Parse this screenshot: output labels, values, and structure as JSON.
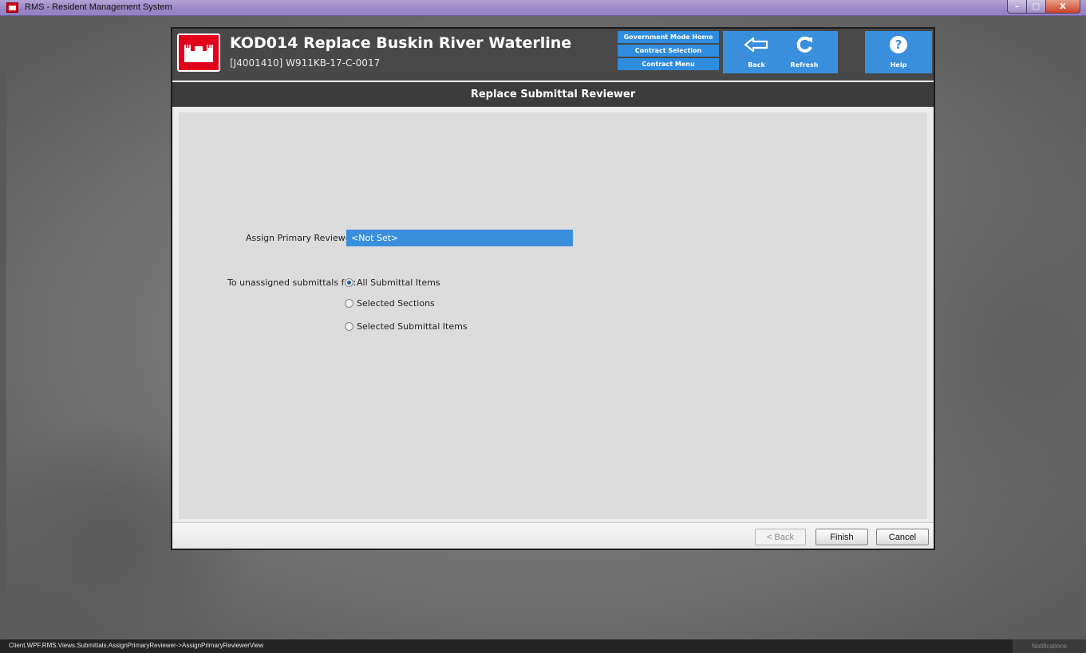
{
  "window": {
    "title": "RMS - Resident Management System",
    "controls": {
      "minimize": "–",
      "maximize": "□",
      "close": "X"
    }
  },
  "header": {
    "title": "KOD014 Replace Buskin River Waterline",
    "subtitle": "[J4001410] W911KB-17-C-0017",
    "nav": {
      "government_mode_home": "Government Mode Home",
      "contract_selection": "Contract Selection",
      "contract_menu": "Contract Menu"
    },
    "tiles": {
      "back": "Back",
      "refresh": "Refresh",
      "help": "Help"
    },
    "accent_color": "#3a8fdd",
    "logo_color": "#e3001b"
  },
  "page": {
    "title": "Replace Submittal Reviewer"
  },
  "form": {
    "primary_reviewer_label": "Assign Primary Reviewer",
    "primary_reviewer_value": "<Not Set>",
    "unassigned_label": "To unassigned submittals for:",
    "options": [
      {
        "label": "All Submittal Items",
        "checked": true
      },
      {
        "label": "Selected Sections",
        "checked": false
      },
      {
        "label": "Selected Submittal Items",
        "checked": false
      }
    ]
  },
  "footer": {
    "back_label": "< Back",
    "finish_label": "Finish",
    "cancel_label": "Cancel"
  },
  "status": {
    "text": "Client.WPF.RMS.Views.Submittals.AssignPrimaryReviewer->AssignPrimaryReviewerView",
    "notifications_label": "Notifications"
  }
}
